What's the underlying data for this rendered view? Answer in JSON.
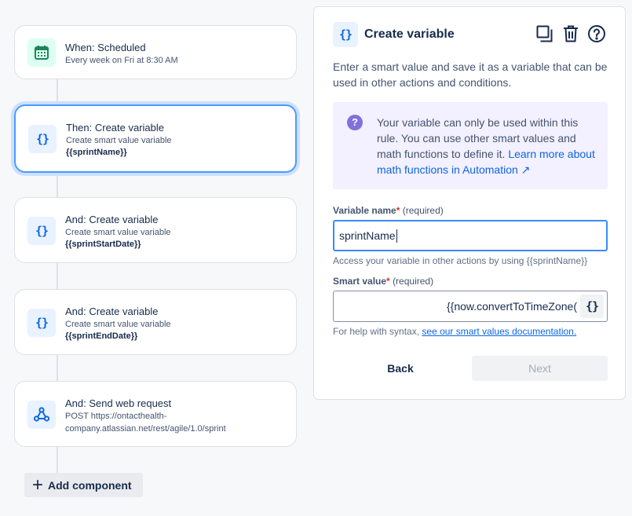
{
  "flow": {
    "items": [
      {
        "title": "When: Scheduled",
        "subtitle": "Every week on Fri at 8:30 AM",
        "detail": "",
        "icon": "calendar-icon"
      },
      {
        "title": "Then: Create variable",
        "subtitle": "Create smart value variable",
        "detail": "{{sprintName}}",
        "icon": "braces-icon"
      },
      {
        "title": "And: Create variable",
        "subtitle": "Create smart value variable",
        "detail": "{{sprintStartDate}}",
        "icon": "braces-icon"
      },
      {
        "title": "And: Create variable",
        "subtitle": "Create smart value variable",
        "detail": "{{sprintEndDate}}",
        "icon": "braces-icon"
      },
      {
        "title": "And: Send web request",
        "subtitle": "POST https://ontacthealth-company.atlassian.net/rest/agile/1.0/sprint",
        "detail": "",
        "icon": "webhook-icon"
      }
    ],
    "add_component": "Add component"
  },
  "icons": {
    "braces": "{}",
    "info": "?"
  },
  "panel": {
    "title": "Create variable",
    "description": "Enter a smart value and save it as a variable that can be used in other actions and conditions.",
    "info_text": "Your variable can only be used within this rule. You can use other smart values and math functions to define it.",
    "info_link": "Learn more about math functions in Automation ↗",
    "variable_name": {
      "label": "Variable name",
      "asterisk": "*",
      "required": "(required)",
      "value": "sprintName",
      "helper": "Access your variable in other actions by using {{sprintName}}"
    },
    "smart_value": {
      "label": "Smart value",
      "asterisk": "*",
      "required": "(required)",
      "value": "{{now.convertToTimeZone(",
      "helper": "For help with syntax,",
      "helper_link": "see our smart values documentation."
    },
    "back": "Back",
    "next": "Next"
  },
  "colors": {
    "accent": "#0c66e4",
    "selected_border": "#4c9aff",
    "info_bg": "#f3f0ff",
    "info_icon": "#8270db"
  }
}
